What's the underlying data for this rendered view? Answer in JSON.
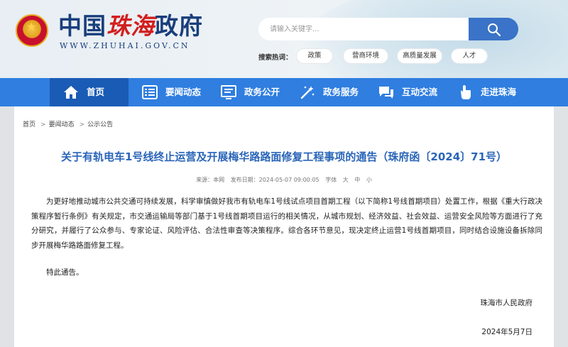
{
  "header": {
    "title_part1": "中国",
    "title_part2": "珠海",
    "title_part3": "政府",
    "url": "WWW.ZHUHAI.GOV.CN",
    "search_placeholder": "请输入关键字...",
    "hot_label": "搜索热词：",
    "hot_tags": [
      "政策",
      "营商环境",
      "高质量发展",
      "人才"
    ]
  },
  "nav": {
    "items": [
      {
        "label": "首页",
        "icon": "home-icon"
      },
      {
        "label": "要闻动态",
        "icon": "news-list-icon"
      },
      {
        "label": "政务公开",
        "icon": "document-icon"
      },
      {
        "label": "政务服务",
        "icon": "service-icon"
      },
      {
        "label": "互动交流",
        "icon": "chat-icon"
      },
      {
        "label": "走进珠海",
        "icon": "hand-pointer-icon"
      }
    ]
  },
  "breadcrumb": [
    "首页",
    "要闻动态",
    "公示公告"
  ],
  "breadcrumb_sep": ">",
  "article": {
    "title": "关于有轨电车1号线终止运营及开展梅华路路面修复工程事项的通告（珠府函〔2024〕71号）",
    "source": "来源：本网",
    "publish_time": "发布日期：2024-05-07 09:00:05",
    "font_label": "字体",
    "font_sizes": [
      "大",
      "中",
      "小"
    ],
    "body": "为更好地推动城市公共交通可持续发展，科学审慎做好我市有轨电车1号线试点项目首期工程（以下简称1号线首期项目）处置工作，根据《重大行政决策程序暂行条例》有关规定，市交通运输局等部门基于1号线首期项目运行的相关情况，从城市规划、经济效益、社会效益、运营安全风险等方面进行了充分研究，并履行了公众参与、专家论证、风险评估、合法性审查等决策程序。综合各环节意见，现决定终止运营1号线首期项目，同时结合设施设备拆除同步开展梅华路路面修复工程。",
    "closing": "特此通告。",
    "signature": "珠海市人民政府",
    "date": "2024年5月7日"
  }
}
